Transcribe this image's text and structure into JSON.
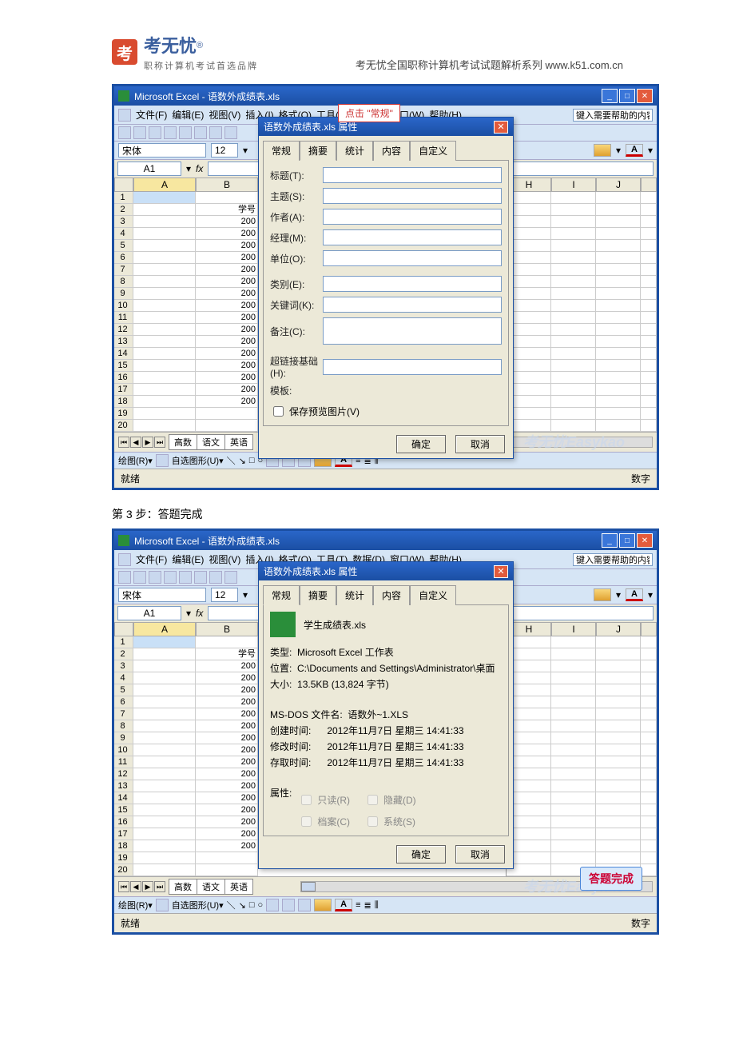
{
  "page_header": {
    "logo_char": "考",
    "logo_text": "考无忧",
    "logo_sub": "职称计算机考试首选品牌",
    "right": "考无忧全国职称计算机考试试题解析系列 www.k51.com.cn"
  },
  "step3_label": "第 3 步：答题完成",
  "excel": {
    "title": "Microsoft Excel - 语数外成绩表.xls",
    "menus": [
      "文件(F)",
      "编辑(E)",
      "视图(V)",
      "插入(I)",
      "格式(O)",
      "工具(T)",
      "数据(D)",
      "窗口(W)",
      "帮助(H)"
    ],
    "help_placeholder": "键入需要帮助的内容",
    "font_name": "宋体",
    "font_size": "12",
    "cell_ref": "A1",
    "fx": "fx",
    "cols_left": [
      "",
      "A",
      "B"
    ],
    "cols_right": [
      "H",
      "I",
      "J"
    ],
    "row2_B_label": "学号",
    "row_numbers": [
      1,
      2,
      3,
      4,
      5,
      6,
      7,
      8,
      9,
      10,
      11,
      12,
      13,
      14,
      15,
      16,
      17,
      18,
      19,
      20
    ],
    "b_values": [
      "",
      "学号",
      "200",
      "200",
      "200",
      "200",
      "200",
      "200",
      "200",
      "200",
      "200",
      "200",
      "200",
      "200",
      "200",
      "200",
      "200",
      "200",
      "",
      ""
    ],
    "sheet_tabs": [
      "高数",
      "语文",
      "英语"
    ],
    "draw_label": "绘图(R)▾",
    "autoshape_label": "自选图形(U)▾",
    "status_left": "就绪",
    "status_right": "数字",
    "watermark": "考无忧Easykao"
  },
  "callout": "点击 \"常规\"",
  "dialog": {
    "title": "语数外成绩表.xls 属性",
    "tabs": [
      "常规",
      "摘要",
      "统计",
      "内容",
      "自定义"
    ],
    "summary": {
      "labels": {
        "title": "标题(T):",
        "subject": "主题(S):",
        "author": "作者(A):",
        "manager": "经理(M):",
        "company": "单位(O):",
        "category": "类别(E):",
        "keywords": "关键词(K):",
        "comments": "备注(C):",
        "hyperlink": "超链接基础(H):",
        "template": "模板:",
        "save_preview": "保存预览图片(V)"
      }
    },
    "general": {
      "filename": "学生成绩表.xls",
      "type_label": "类型:",
      "type_value": "Microsoft Excel 工作表",
      "location_label": "位置:",
      "location_value": "C:\\Documents and Settings\\Administrator\\桌面",
      "size_label": "大小:",
      "size_value": "13.5KB (13,824 字节)",
      "msdos_label": "MS-DOS 文件名:",
      "msdos_value": "语数外~1.XLS",
      "created_label": "创建时间:",
      "created_value": "2012年11月7日 星期三 14:41:33",
      "modified_label": "修改时间:",
      "modified_value": "2012年11月7日 星期三 14:41:33",
      "accessed_label": "存取时间:",
      "accessed_value": "2012年11月7日 星期三 14:41:33",
      "attrib_label": "属性:",
      "attribs": [
        "只读(R)",
        "隐藏(D)",
        "档案(C)",
        "系统(S)"
      ]
    },
    "ok": "确定",
    "cancel": "取消"
  },
  "answer_done": "答题完成"
}
